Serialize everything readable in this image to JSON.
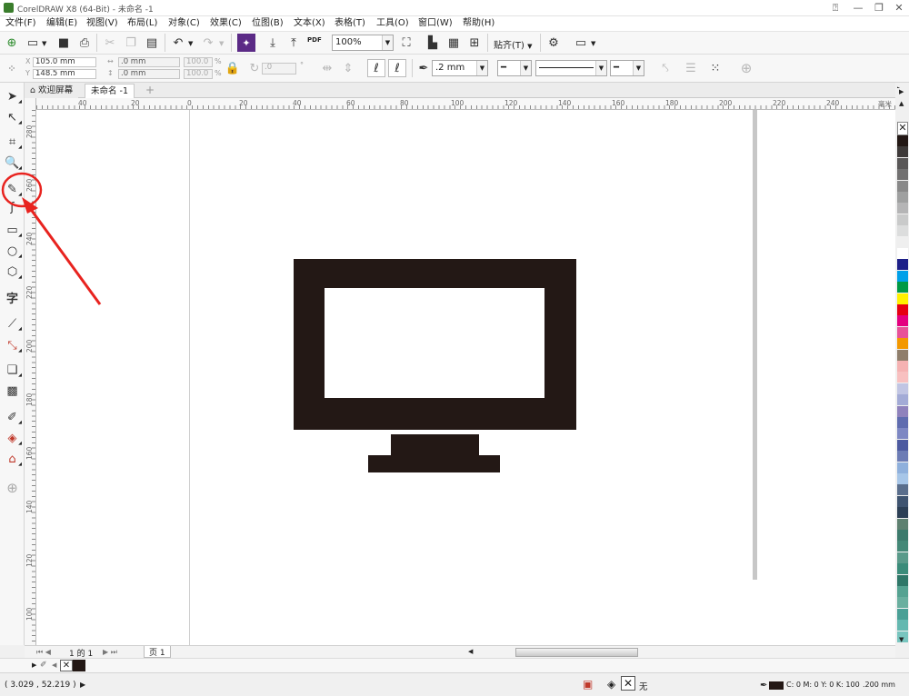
{
  "window": {
    "title": "CorelDRAW X8 (64-Bit) - 未命名 -1",
    "minimize": "—",
    "restore": "❐",
    "close": "✕",
    "help_icon": "⍰"
  },
  "menu": [
    "文件(F)",
    "编辑(E)",
    "视图(V)",
    "布局(L)",
    "对象(C)",
    "效果(C)",
    "位图(B)",
    "文本(X)",
    "表格(T)",
    "工具(O)",
    "窗口(W)",
    "帮助(H)"
  ],
  "standard_toolbar": {
    "zoom": "100%",
    "snap_label": "贴齐(T)",
    "pdf_label": "PDF"
  },
  "property_bar": {
    "x": "105.0 mm",
    "y": "148.5 mm",
    "width": ".0 mm",
    "height": ".0 mm",
    "scale_x": "100.0",
    "scale_y": "100.0",
    "pct": "%",
    "angle": ".0",
    "degree": "°",
    "outline_width": ".2 mm"
  },
  "doc_tabs": {
    "welcome": "欢迎屏幕",
    "active": "未命名 -1",
    "add": "+"
  },
  "ruler": {
    "top": [
      "40",
      "20",
      "0",
      "20",
      "40",
      "60",
      "80",
      "100",
      "120",
      "140",
      "160",
      "180",
      "200",
      "220",
      "240"
    ],
    "left": [
      "280",
      "260",
      "240",
      "220",
      "200",
      "180",
      "160",
      "140",
      "120",
      "100",
      "80",
      "60",
      "40",
      "20"
    ],
    "unit": "毫米"
  },
  "page_nav": {
    "page_of": "1 的 1",
    "page_tab": "页 1"
  },
  "palette": [
    "#231815",
    "#3e3a39",
    "#595757",
    "#727171",
    "#898989",
    "#9fa0a0",
    "#b5b5b6",
    "#c9caca",
    "#dcdddd",
    "#efefef",
    "#ffffff",
    "#1d2088",
    "#00a0e9",
    "#009944",
    "#fff100",
    "#e60012",
    "#e4007f",
    "#e85298",
    "#f39800",
    "#8f7e6b",
    "#f5b2b2",
    "#f8c0c0",
    "#c1c5e3",
    "#a3abd6",
    "#8f82bc",
    "#5f6caf",
    "#7d87c3",
    "#4d5aa0",
    "#6c7cb5",
    "#8fb0dc",
    "#a7c6e8",
    "#5a6e8c",
    "#3f5470",
    "#2c3f55",
    "#5e8070",
    "#3c7a6c",
    "#448877",
    "#5a9a8a",
    "#3b8c7a",
    "#2f7768",
    "#55a291",
    "#6aaf9f",
    "#4aa096",
    "#64b8b0",
    "#78c5bf"
  ],
  "status": {
    "coords": "( 3.029 , 52.219 )",
    "fill_none": "无",
    "fill_info": "C: 0 M: 0 Y: 0 K: 100",
    "outline": ".200 mm"
  },
  "colors": {
    "shape": "#231815",
    "annotation": "#e8231f",
    "accent_blue": "#0079c1"
  }
}
